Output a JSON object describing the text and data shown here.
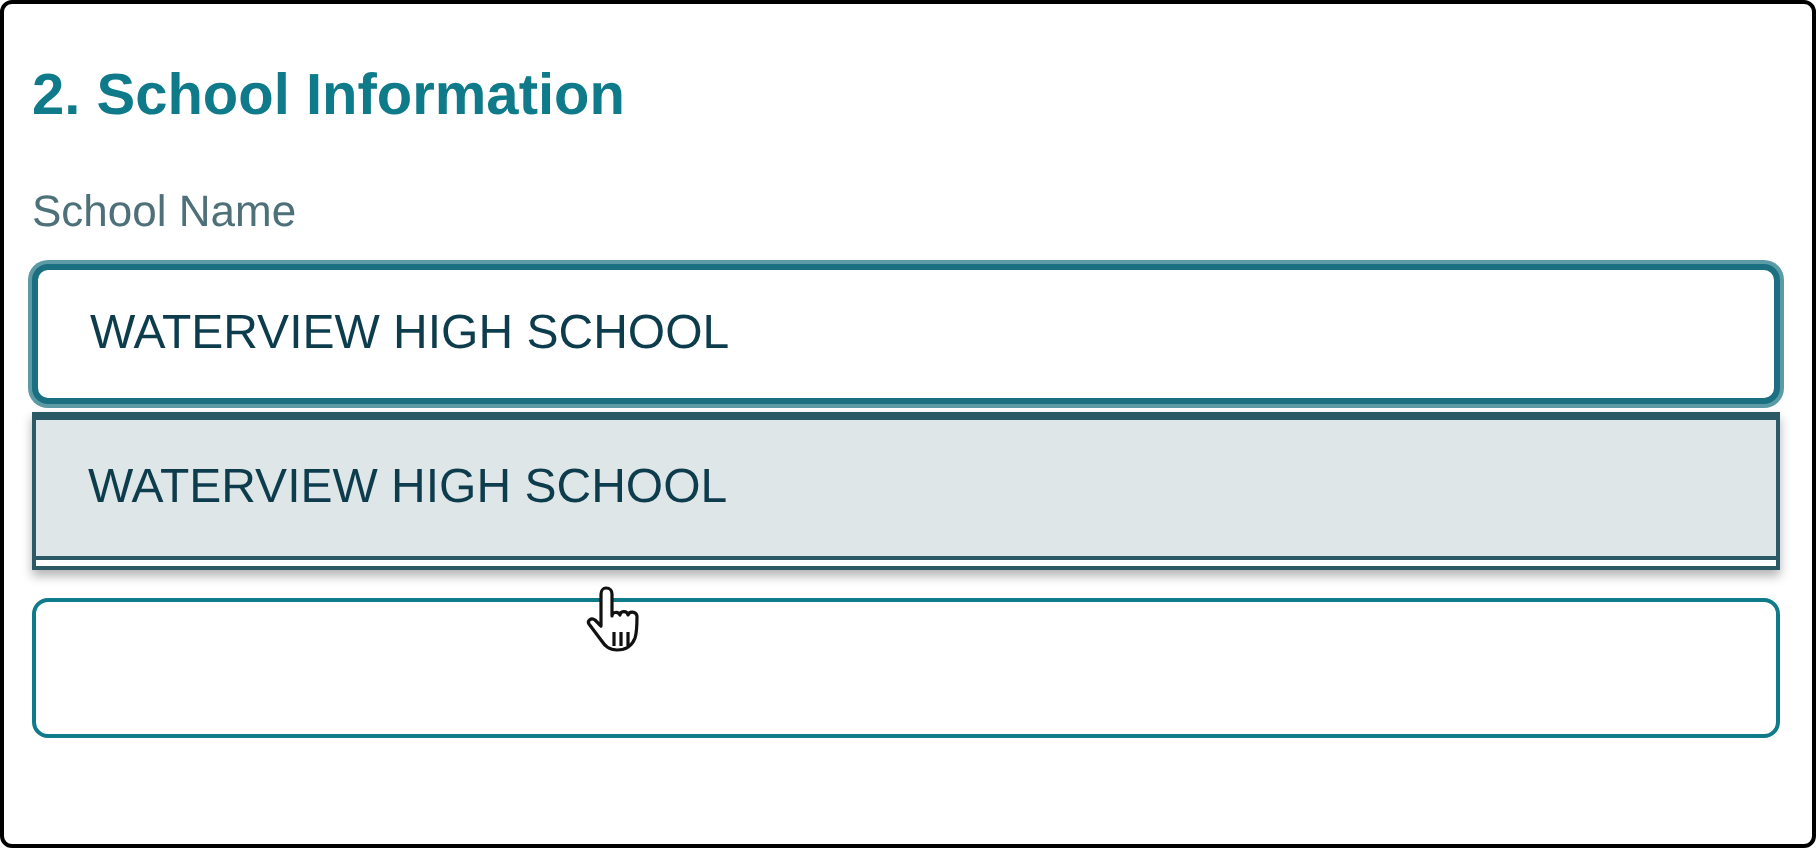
{
  "section_title": "2. School Information",
  "school_name": {
    "label": "School Name",
    "value": "WATERVIEW HIGH SCHOOL",
    "focused": true,
    "suggestions": [
      {
        "label": "WATERVIEW HIGH SCHOOL",
        "selected": true
      }
    ]
  }
}
